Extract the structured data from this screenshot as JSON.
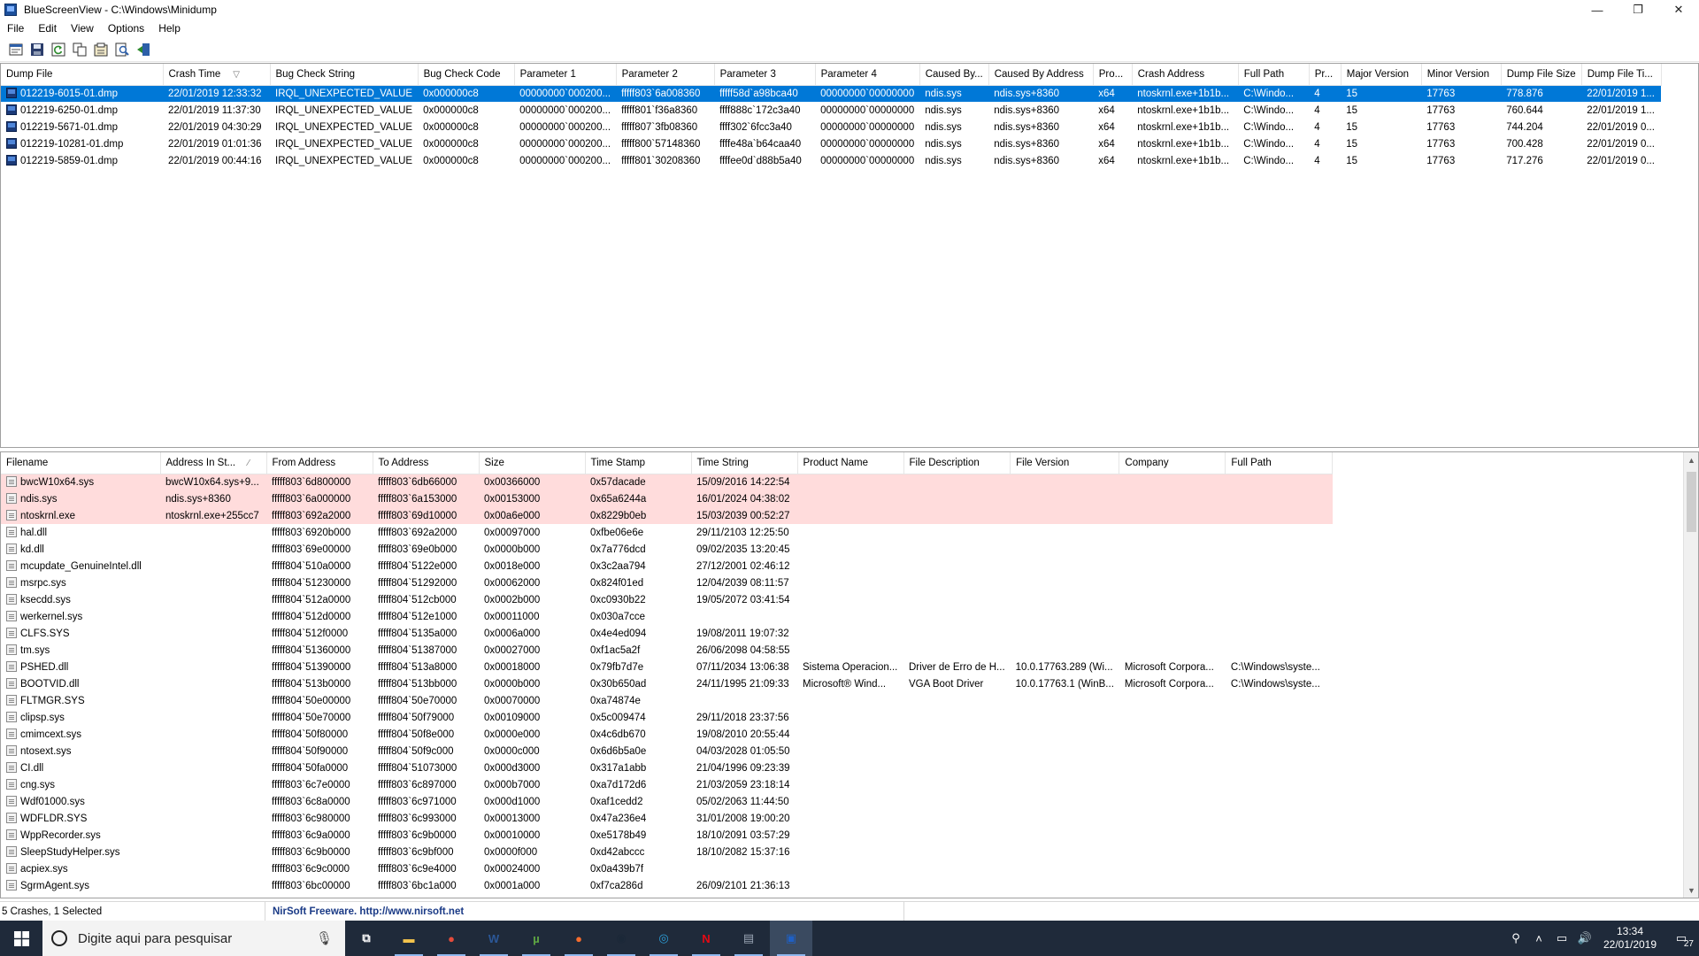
{
  "window": {
    "title": "BlueScreenView  -  C:\\Windows\\Minidump",
    "minimize_glyph": "—",
    "maximize_glyph": "❐",
    "close_glyph": "✕"
  },
  "menu": [
    "File",
    "Edit",
    "View",
    "Options",
    "Help"
  ],
  "toolbar": {
    "buttons": [
      "html-report-icon",
      "save-icon",
      "refresh-icon",
      "copy-icon",
      "properties-icon",
      "find-icon",
      "exit-icon"
    ]
  },
  "crash_list": {
    "columns": [
      {
        "label": "Dump File"
      },
      {
        "label": "Crash Time"
      },
      {
        "label": "Bug Check String"
      },
      {
        "label": "Bug Check Code"
      },
      {
        "label": "Parameter 1"
      },
      {
        "label": "Parameter 2"
      },
      {
        "label": "Parameter 3"
      },
      {
        "label": "Parameter 4"
      },
      {
        "label": "Caused By..."
      },
      {
        "label": "Caused By Address"
      },
      {
        "label": "Pro..."
      },
      {
        "label": "Crash Address"
      },
      {
        "label": "Full Path"
      },
      {
        "label": "Pr..."
      },
      {
        "label": "Major Version"
      },
      {
        "label": "Minor Version"
      },
      {
        "label": "Dump File Size"
      },
      {
        "label": "Dump File Ti..."
      }
    ],
    "rows": [
      {
        "selected": true,
        "cells": [
          "012219-6015-01.dmp",
          "22/01/2019 12:33:32",
          "IRQL_UNEXPECTED_VALUE",
          "0x000000c8",
          "00000000`000200...",
          "fffff803`6a008360",
          "fffff58d`a98bca40",
          "00000000`00000000",
          "ndis.sys",
          "ndis.sys+8360",
          "x64",
          "ntoskrnl.exe+1b1b...",
          "C:\\Windo...",
          "4",
          "15",
          "17763",
          "778.876",
          "22/01/2019 1..."
        ]
      },
      {
        "selected": false,
        "cells": [
          "012219-6250-01.dmp",
          "22/01/2019 11:37:30",
          "IRQL_UNEXPECTED_VALUE",
          "0x000000c8",
          "00000000`000200...",
          "fffff801`f36a8360",
          "ffff888c`172c3a40",
          "00000000`00000000",
          "ndis.sys",
          "ndis.sys+8360",
          "x64",
          "ntoskrnl.exe+1b1b...",
          "C:\\Windo...",
          "4",
          "15",
          "17763",
          "760.644",
          "22/01/2019 1..."
        ]
      },
      {
        "selected": false,
        "cells": [
          "012219-5671-01.dmp",
          "22/01/2019 04:30:29",
          "IRQL_UNEXPECTED_VALUE",
          "0x000000c8",
          "00000000`000200...",
          "fffff807`3fb08360",
          "ffff302`6fcc3a40",
          "00000000`00000000",
          "ndis.sys",
          "ndis.sys+8360",
          "x64",
          "ntoskrnl.exe+1b1b...",
          "C:\\Windo...",
          "4",
          "15",
          "17763",
          "744.204",
          "22/01/2019 0..."
        ]
      },
      {
        "selected": false,
        "cells": [
          "012219-10281-01.dmp",
          "22/01/2019 01:01:36",
          "IRQL_UNEXPECTED_VALUE",
          "0x000000c8",
          "00000000`000200...",
          "fffff800`57148360",
          "ffffe48a`b64caa40",
          "00000000`00000000",
          "ndis.sys",
          "ndis.sys+8360",
          "x64",
          "ntoskrnl.exe+1b1b...",
          "C:\\Windo...",
          "4",
          "15",
          "17763",
          "700.428",
          "22/01/2019 0..."
        ]
      },
      {
        "selected": false,
        "cells": [
          "012219-5859-01.dmp",
          "22/01/2019 00:44:16",
          "IRQL_UNEXPECTED_VALUE",
          "0x000000c8",
          "00000000`000200...",
          "fffff801`30208360",
          "ffffee0d`d88b5a40",
          "00000000`00000000",
          "ndis.sys",
          "ndis.sys+8360",
          "x64",
          "ntoskrnl.exe+1b1b...",
          "C:\\Windo...",
          "4",
          "15",
          "17763",
          "717.276",
          "22/01/2019 0..."
        ]
      }
    ]
  },
  "module_list": {
    "columns": [
      {
        "label": "Filename"
      },
      {
        "label": "Address In St..."
      },
      {
        "label": "From Address"
      },
      {
        "label": "To Address"
      },
      {
        "label": "Size"
      },
      {
        "label": "Time Stamp"
      },
      {
        "label": "Time String"
      },
      {
        "label": "Product Name"
      },
      {
        "label": "File Description"
      },
      {
        "label": "File Version"
      },
      {
        "label": "Company"
      },
      {
        "label": "Full Path"
      }
    ],
    "rows": [
      {
        "suspect": true,
        "cells": [
          "bwcW10x64.sys",
          "bwcW10x64.sys+9...",
          "fffff803`6d800000",
          "fffff803`6db66000",
          "0x00366000",
          "0x57dacade",
          "15/09/2016 14:22:54",
          "",
          "",
          "",
          "",
          ""
        ]
      },
      {
        "suspect": true,
        "cells": [
          "ndis.sys",
          "ndis.sys+8360",
          "fffff803`6a000000",
          "fffff803`6a153000",
          "0x00153000",
          "0x65a6244a",
          "16/01/2024 04:38:02",
          "",
          "",
          "",
          "",
          ""
        ]
      },
      {
        "suspect": true,
        "cells": [
          "ntoskrnl.exe",
          "ntoskrnl.exe+255cc7",
          "fffff803`692a2000",
          "fffff803`69d10000",
          "0x00a6e000",
          "0x8229b0eb",
          "15/03/2039 00:52:27",
          "",
          "",
          "",
          "",
          ""
        ]
      },
      {
        "suspect": false,
        "cells": [
          "hal.dll",
          "",
          "fffff803`6920b000",
          "fffff803`692a2000",
          "0x00097000",
          "0xfbe06e6e",
          "29/11/2103 12:25:50",
          "",
          "",
          "",
          "",
          ""
        ]
      },
      {
        "suspect": false,
        "cells": [
          "kd.dll",
          "",
          "fffff803`69e00000",
          "fffff803`69e0b000",
          "0x0000b000",
          "0x7a776dcd",
          "09/02/2035 13:20:45",
          "",
          "",
          "",
          "",
          ""
        ]
      },
      {
        "suspect": false,
        "cells": [
          "mcupdate_GenuineIntel.dll",
          "",
          "fffff804`510a0000",
          "fffff804`5122e000",
          "0x0018e000",
          "0x3c2aa794",
          "27/12/2001 02:46:12",
          "",
          "",
          "",
          "",
          ""
        ]
      },
      {
        "suspect": false,
        "cells": [
          "msrpc.sys",
          "",
          "fffff804`51230000",
          "fffff804`51292000",
          "0x00062000",
          "0x824f01ed",
          "12/04/2039 08:11:57",
          "",
          "",
          "",
          "",
          ""
        ]
      },
      {
        "suspect": false,
        "cells": [
          "ksecdd.sys",
          "",
          "fffff804`512a0000",
          "fffff804`512cb000",
          "0x0002b000",
          "0xc0930b22",
          "19/05/2072 03:41:54",
          "",
          "",
          "",
          "",
          ""
        ]
      },
      {
        "suspect": false,
        "cells": [
          "werkernel.sys",
          "",
          "fffff804`512d0000",
          "fffff804`512e1000",
          "0x00011000",
          "0x030a7cce",
          "",
          "",
          "",
          "",
          "",
          ""
        ]
      },
      {
        "suspect": false,
        "cells": [
          "CLFS.SYS",
          "",
          "fffff804`512f0000",
          "fffff804`5135a000",
          "0x0006a000",
          "0x4e4ed094",
          "19/08/2011 19:07:32",
          "",
          "",
          "",
          "",
          ""
        ]
      },
      {
        "suspect": false,
        "cells": [
          "tm.sys",
          "",
          "fffff804`51360000",
          "fffff804`51387000",
          "0x00027000",
          "0xf1ac5a2f",
          "26/06/2098 04:58:55",
          "",
          "",
          "",
          "",
          ""
        ]
      },
      {
        "suspect": false,
        "cells": [
          "PSHED.dll",
          "",
          "fffff804`51390000",
          "fffff804`513a8000",
          "0x00018000",
          "0x79fb7d7e",
          "07/11/2034 13:06:38",
          "Sistema Operacion...",
          "Driver de Erro de H...",
          "10.0.17763.289 (Wi...",
          "Microsoft Corpora...",
          "C:\\Windows\\syste..."
        ]
      },
      {
        "suspect": false,
        "cells": [
          "BOOTVID.dll",
          "",
          "fffff804`513b0000",
          "fffff804`513bb000",
          "0x0000b000",
          "0x30b650ad",
          "24/11/1995 21:09:33",
          "Microsoft® Wind...",
          "VGA Boot Driver",
          "10.0.17763.1 (WinB...",
          "Microsoft Corpora...",
          "C:\\Windows\\syste..."
        ]
      },
      {
        "suspect": false,
        "cells": [
          "FLTMGR.SYS",
          "",
          "fffff804`50e00000",
          "fffff804`50e70000",
          "0x00070000",
          "0xa74874e",
          "",
          "",
          "",
          "",
          "",
          ""
        ]
      },
      {
        "suspect": false,
        "cells": [
          "clipsp.sys",
          "",
          "fffff804`50e70000",
          "fffff804`50f79000",
          "0x00109000",
          "0x5c009474",
          "29/11/2018 23:37:56",
          "",
          "",
          "",
          "",
          ""
        ]
      },
      {
        "suspect": false,
        "cells": [
          "cmimcext.sys",
          "",
          "fffff804`50f80000",
          "fffff804`50f8e000",
          "0x0000e000",
          "0x4c6db670",
          "19/08/2010 20:55:44",
          "",
          "",
          "",
          "",
          ""
        ]
      },
      {
        "suspect": false,
        "cells": [
          "ntosext.sys",
          "",
          "fffff804`50f90000",
          "fffff804`50f9c000",
          "0x0000c000",
          "0x6d6b5a0e",
          "04/03/2028 01:05:50",
          "",
          "",
          "",
          "",
          ""
        ]
      },
      {
        "suspect": false,
        "cells": [
          "CI.dll",
          "",
          "fffff804`50fa0000",
          "fffff804`51073000",
          "0x000d3000",
          "0x317a1abb",
          "21/04/1996 09:23:39",
          "",
          "",
          "",
          "",
          ""
        ]
      },
      {
        "suspect": false,
        "cells": [
          "cng.sys",
          "",
          "fffff803`6c7e0000",
          "fffff803`6c897000",
          "0x000b7000",
          "0xa7d172d6",
          "21/03/2059 23:18:14",
          "",
          "",
          "",
          "",
          ""
        ]
      },
      {
        "suspect": false,
        "cells": [
          "Wdf01000.sys",
          "",
          "fffff803`6c8a0000",
          "fffff803`6c971000",
          "0x000d1000",
          "0xaf1cedd2",
          "05/02/2063 11:44:50",
          "",
          "",
          "",
          "",
          ""
        ]
      },
      {
        "suspect": false,
        "cells": [
          "WDFLDR.SYS",
          "",
          "fffff803`6c980000",
          "fffff803`6c993000",
          "0x00013000",
          "0x47a236e4",
          "31/01/2008 19:00:20",
          "",
          "",
          "",
          "",
          ""
        ]
      },
      {
        "suspect": false,
        "cells": [
          "WppRecorder.sys",
          "",
          "fffff803`6c9a0000",
          "fffff803`6c9b0000",
          "0x00010000",
          "0xe5178b49",
          "18/10/2091 03:57:29",
          "",
          "",
          "",
          "",
          ""
        ]
      },
      {
        "suspect": false,
        "cells": [
          "SleepStudyHelper.sys",
          "",
          "fffff803`6c9b0000",
          "fffff803`6c9bf000",
          "0x0000f000",
          "0xd42abccc",
          "18/10/2082 15:37:16",
          "",
          "",
          "",
          "",
          ""
        ]
      },
      {
        "suspect": false,
        "cells": [
          "acpiex.sys",
          "",
          "fffff803`6c9c0000",
          "fffff803`6c9e4000",
          "0x00024000",
          "0x0a439b7f",
          "",
          "",
          "",
          "",
          "",
          ""
        ]
      },
      {
        "suspect": false,
        "cells": [
          "SgrmAgent.sys",
          "",
          "fffff803`6bc00000",
          "fffff803`6bc1a000",
          "0x0001a000",
          "0xf7ca286d",
          "26/09/2101 21:36:13",
          "",
          "",
          "",
          "",
          ""
        ]
      }
    ]
  },
  "status": {
    "left": "5 Crashes, 1 Selected",
    "middle": "NirSoft Freeware.  http://www.nirsoft.net"
  },
  "taskbar": {
    "search_placeholder": "Digite aqui para pesquisar",
    "apps": [
      {
        "name": "task-view-icon",
        "glyph": "⧉",
        "color": "#ffffff",
        "running": false,
        "active": false
      },
      {
        "name": "file-explorer-icon",
        "glyph": "▬",
        "color": "#f3c34c",
        "running": true,
        "active": false
      },
      {
        "name": "chrome-icon",
        "glyph": "●",
        "color": "#e44b3b",
        "running": true,
        "active": false
      },
      {
        "name": "word-icon",
        "glyph": "W",
        "color": "#2b5797",
        "running": true,
        "active": false
      },
      {
        "name": "utorrent-icon",
        "glyph": "µ",
        "color": "#5fa843",
        "running": true,
        "active": false
      },
      {
        "name": "origin-icon",
        "glyph": "●",
        "color": "#f56c2d",
        "running": true,
        "active": false
      },
      {
        "name": "steam-icon",
        "glyph": "◉",
        "color": "#1b2838",
        "running": true,
        "active": false
      },
      {
        "name": "cortana-app-icon",
        "glyph": "◎",
        "color": "#2d9fd9",
        "running": true,
        "active": false
      },
      {
        "name": "netflix-icon",
        "glyph": "N",
        "color": "#e50914",
        "running": true,
        "active": false
      },
      {
        "name": "network-tool-icon",
        "glyph": "▤",
        "color": "#9aa6b5",
        "running": true,
        "active": false
      },
      {
        "name": "bluescreenview-icon",
        "glyph": "▣",
        "color": "#1f60c4",
        "running": true,
        "active": true
      }
    ],
    "tray": [
      "person-icon",
      "chevron-up-icon",
      "network-icon",
      "volume-icon"
    ],
    "time": "13:34",
    "date": "22/01/2019",
    "notification_count": "27"
  },
  "colors": {
    "selection": "#0078d7",
    "suspect_row": "#ffdcdc",
    "nirsoft_text": "#1a3a86",
    "taskbar": "#1f2a3a"
  }
}
